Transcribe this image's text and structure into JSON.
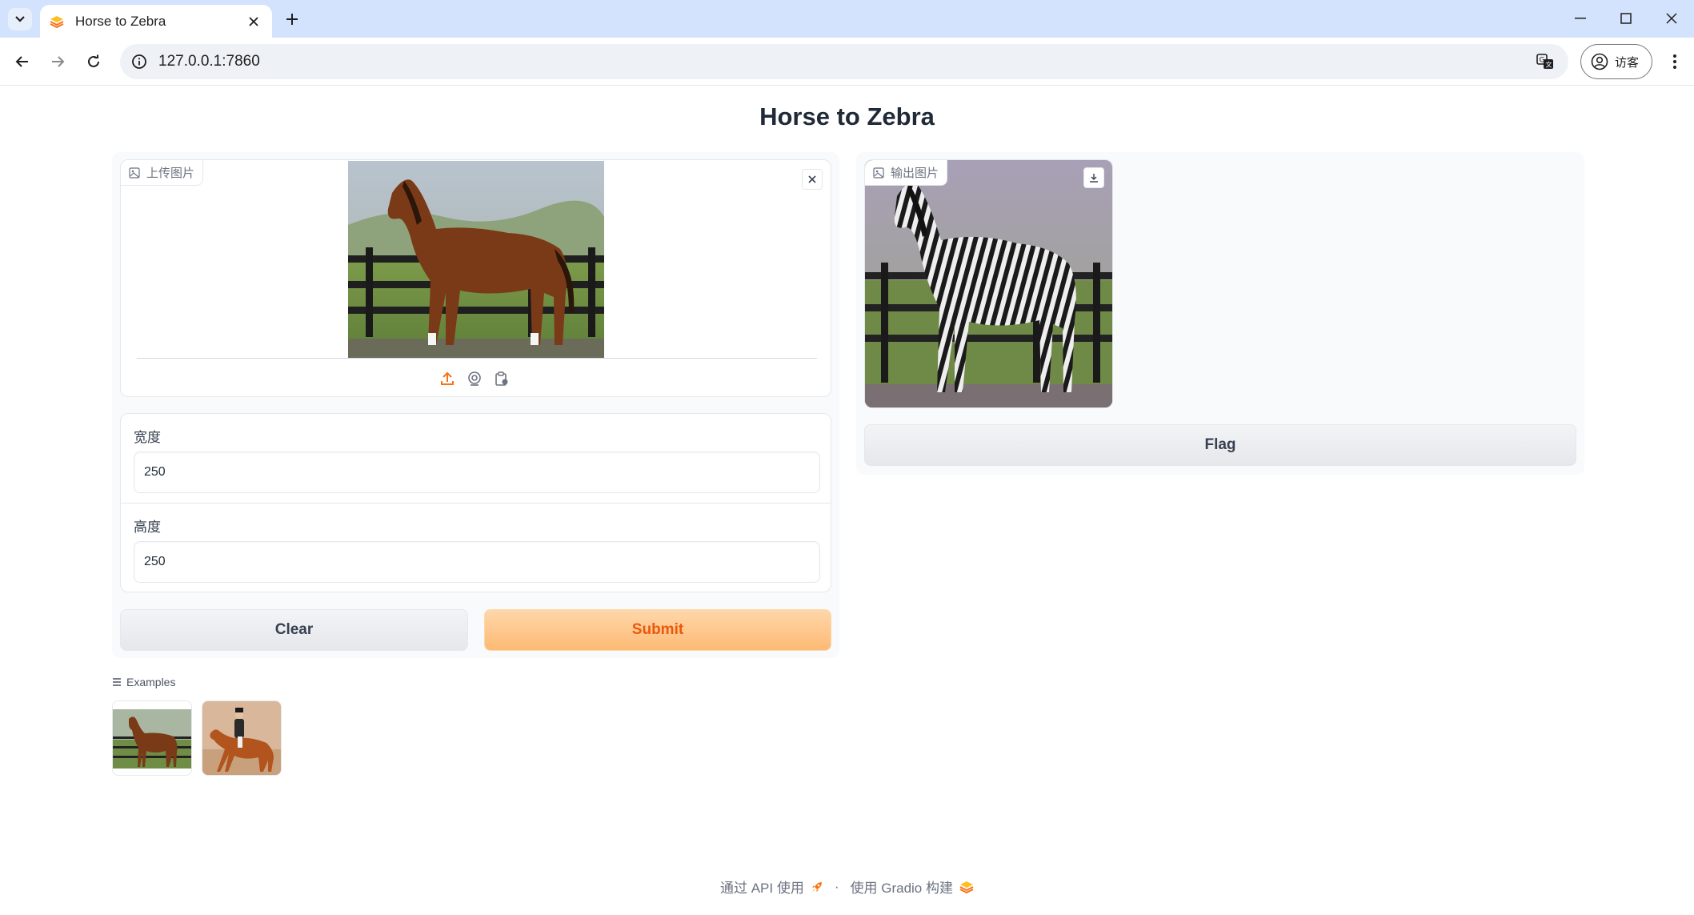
{
  "browser": {
    "tab_title": "Horse to Zebra",
    "url": "127.0.0.1:7860",
    "profile_label": "访客"
  },
  "page": {
    "title": "Horse to Zebra"
  },
  "input_image": {
    "label": "上传图片"
  },
  "fields": {
    "width_label": "宽度",
    "width_value": "250",
    "height_label": "高度",
    "height_value": "250"
  },
  "buttons": {
    "clear": "Clear",
    "submit": "Submit",
    "flag": "Flag"
  },
  "output_image": {
    "label": "输出图片"
  },
  "examples": {
    "label": "Examples"
  },
  "footer": {
    "api_text": "通过 API 使用",
    "separator": "·",
    "built_text": "使用 Gradio 构建"
  },
  "colors": {
    "accent": "#f97316",
    "chrome_tabbar": "#d3e3fd"
  }
}
